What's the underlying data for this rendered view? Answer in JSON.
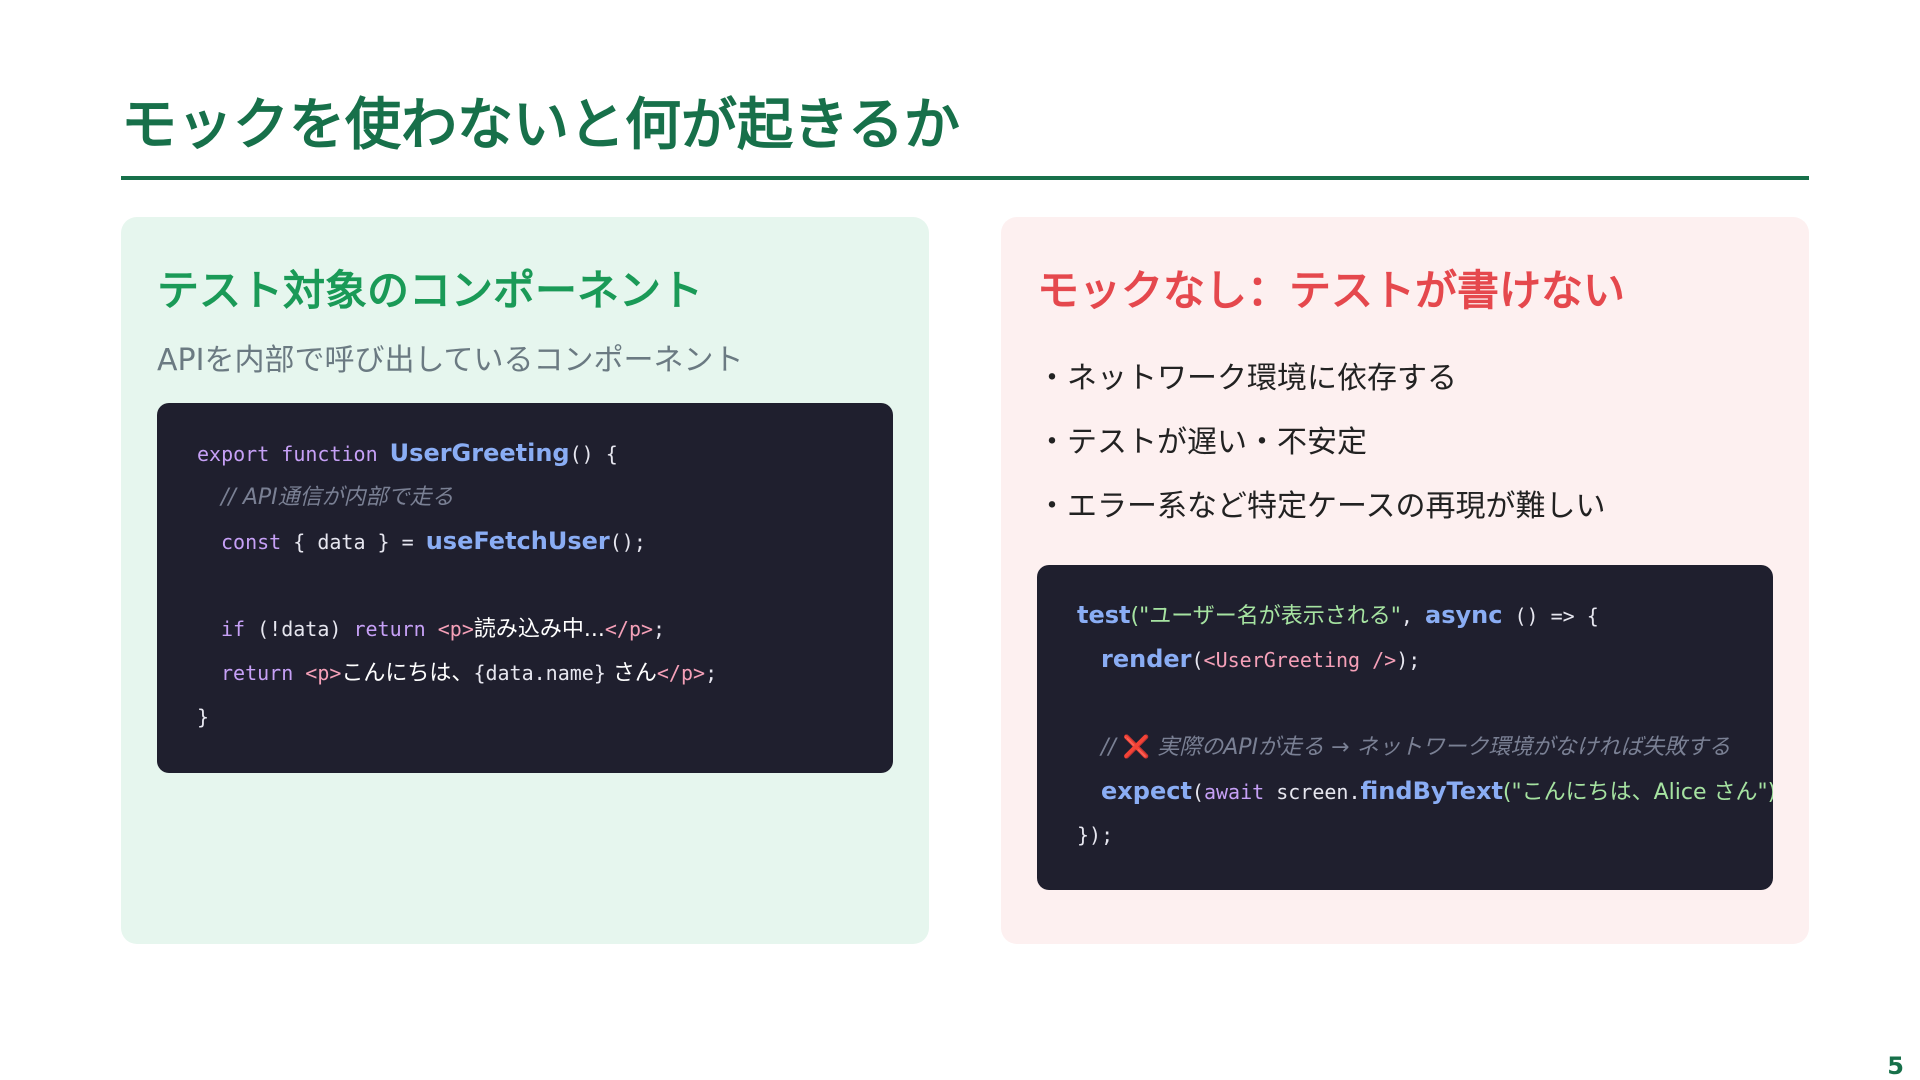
{
  "slide": {
    "title": "モックを使わないと何が起きるか",
    "page_number": "5"
  },
  "left_panel": {
    "heading": "テスト対象のコンポーネント",
    "subtitle": "APIを内部で呼び出しているコンポーネント",
    "code": {
      "l1_kw1": "export",
      "l1_kw2": "function",
      "l1_fn": "UserGreeting",
      "l1_rest": "() {",
      "l2_comment": "// API通信が内部で走る",
      "l3_kw": "const",
      "l3_mid": " { data } = ",
      "l3_fn": "useFetchUser",
      "l3_rest": "();",
      "l5_kw1": "if",
      "l5_mid": " (!data) ",
      "l5_kw2": "return",
      "l5_tag_open": "<p>",
      "l5_text": "読み込み中...",
      "l5_tag_close": "</p>",
      "l5_end": ";",
      "l6_kw": "return",
      "l6_tag_open": "<p>",
      "l6_text1": "こんにちは、",
      "l6_expr": "{data.name}",
      "l6_text2": " さん",
      "l6_tag_close": "</p>",
      "l6_end": ";",
      "l7": "}"
    }
  },
  "right_panel": {
    "heading": "モックなし：テストが書けない",
    "bullets": [
      "・ネットワーク環境に依存する",
      "・テストが遅い・不安定",
      "・エラー系など特定ケースの再現が難しい"
    ],
    "code": {
      "l1_fn": "test",
      "l1_str": "(\"ユーザー名が表示される\"",
      "l1_comma": ", ",
      "l1_async": "async",
      "l1_rest": " () => {",
      "l2_fn": "render",
      "l2_paren_open": "(",
      "l2_tag": "<UserGreeting />",
      "l2_rest": ");",
      "l4_comment_prefix": "// ",
      "l4_x": "❌",
      "l4_comment": " 実際のAPIが走る → ネットワーク環境がなければ失敗する",
      "l5_fn": "expect",
      "l5_paren": "(",
      "l5_await": "await",
      "l5_screen": " screen.",
      "l5_fn2": "findByText",
      "l5_str": "(\"こんにちは、Alice さん\")",
      "l6": "});"
    }
  }
}
